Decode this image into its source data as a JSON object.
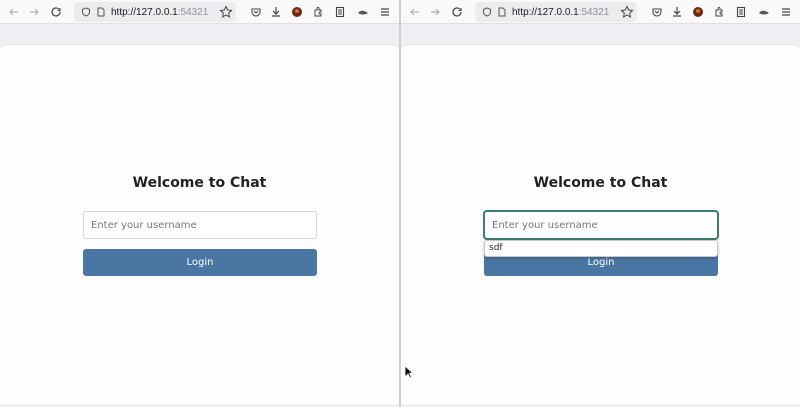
{
  "left_window": {
    "url_host": "http://127.0.0.1",
    "url_port": ":54321",
    "page": {
      "title": "Welcome to Chat",
      "username_placeholder": "Enter your username",
      "login_label": "Login"
    }
  },
  "right_window": {
    "url_host": "http://127.0.0.1",
    "url_port": ":54321",
    "page": {
      "title": "Welcome to Chat",
      "username_placeholder": "Enter your username",
      "login_label": "Login",
      "autocomplete_suggestion": "sdf"
    }
  },
  "toolbar_icons": [
    "back-icon",
    "forward-icon",
    "reload-icon",
    "shield-icon",
    "page-icon",
    "star-icon",
    "pocket-icon",
    "download-icon",
    "avatar-icon",
    "extensions-icon",
    "reader-icon",
    "theme-icon",
    "menu-icon"
  ],
  "colors": {
    "accent": "#4a76a4",
    "focus": "#3b7d70"
  }
}
